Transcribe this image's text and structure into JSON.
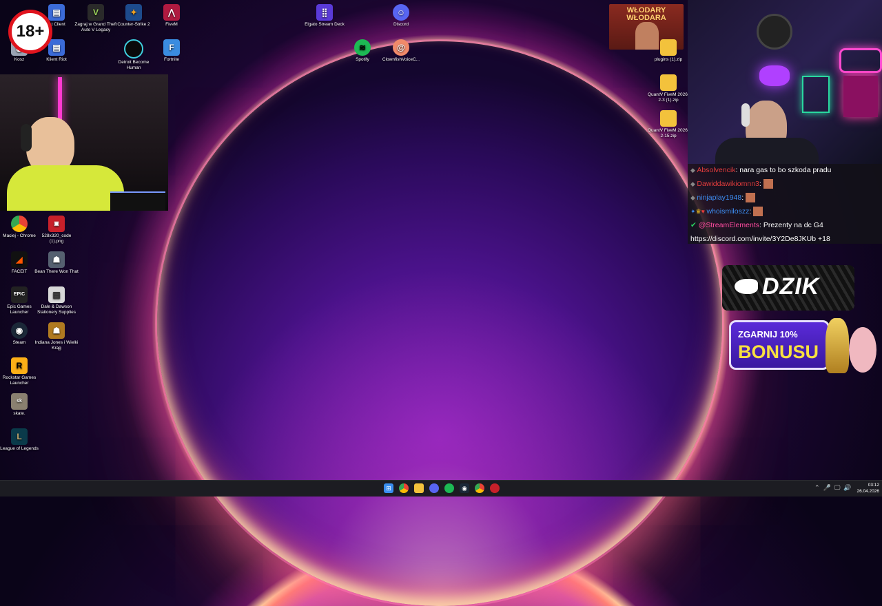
{
  "desktop_icons_left": [
    {
      "label": "Kosz"
    },
    {
      "label": "Klient Riot"
    },
    {
      "label": "Maciej - Chrome"
    },
    {
      "label": "528x320_code (1).png"
    },
    {
      "label": "FACEIT"
    },
    {
      "label": "Bean There Won That"
    },
    {
      "label": "Epic Games Launcher"
    },
    {
      "label": "Dale & Dawson Stationery Supplies"
    },
    {
      "label": "Steam"
    },
    {
      "label": "Indiana Jones i Wielki Krąg"
    },
    {
      "label": "Rockstar Games Launcher"
    },
    {
      "label": "skate."
    },
    {
      "label": "League of Legends"
    }
  ],
  "desktop_icons_top": [
    {
      "label": "...t Client"
    },
    {
      "label": "Zagraj w Grand Theft Auto V Legacy"
    },
    {
      "label": "Counter-Strike 2"
    },
    {
      "label": "FiveM"
    },
    {
      "label": "Detroit Become Human"
    },
    {
      "label": "Fortnite"
    },
    {
      "label": "Elgato Stream Deck"
    },
    {
      "label": "Discord"
    },
    {
      "label": "Spotify"
    },
    {
      "label": "ClownfishVoiceC..."
    }
  ],
  "desktop_icons_right": [
    {
      "label": "plugins (1).zip"
    },
    {
      "label": "QuantV FiveM 2026-2-3 (1).zip"
    },
    {
      "label": "QuantV FiveM 2026-2-15.zip"
    }
  ],
  "overlay": {
    "age_badge": "18+",
    "banner_text": "WŁODARY WŁODARA",
    "dzik_logo": "DZIK",
    "promo_line1": "ZGARNIJ 10%",
    "promo_line2": "BONUSU"
  },
  "chat": [
    {
      "user": "Absolvencik",
      "text": ": nara gas to bo szkoda pradu",
      "color": "#e23c3c"
    },
    {
      "user": "Dawiddawikiomnn3",
      "text": ":",
      "color": "#e23c3c"
    },
    {
      "user": "ninjaplay1948",
      "text": ":",
      "color": "#3d8cf0"
    },
    {
      "user": "whoismiloszz",
      "text": ":",
      "color": "#3d8cf0"
    },
    {
      "user": "@StreamElements",
      "text": ": Prezenty na dc G4",
      "color": "#ff4ba0"
    },
    {
      "user": "",
      "text": "https://discord.com/invite/3Y2De8JKUb +18",
      "color": "#ffffff"
    }
  ],
  "taskbar": {
    "time": "03:12",
    "date": "26.04.2026"
  },
  "colors": {
    "accent": "#c84fb8",
    "chat_bg": "#141418"
  }
}
